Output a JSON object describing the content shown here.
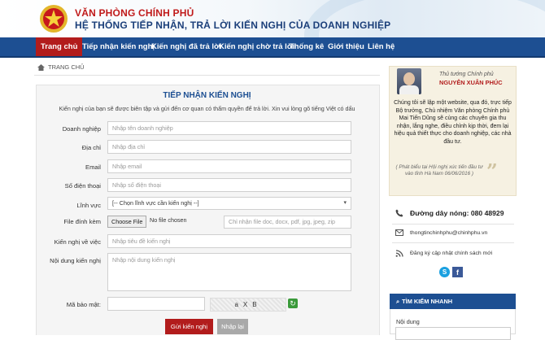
{
  "header": {
    "org_name": "VĂN PHÒNG CHÍNH PHỦ",
    "system_name": "HỆ THỐNG TIẾP NHẬN, TRẢ LỜI KIẾN NGHỊ CỦA DOANH NGHIỆP"
  },
  "nav": {
    "items": [
      "Trang chủ",
      "Tiếp nhận kiến nghị",
      "Kiến nghị đã trả lời",
      "Kiến nghị chờ trả lời",
      "Thống kê",
      "Giới thiệu",
      "Liên hệ"
    ]
  },
  "breadcrumb": {
    "home": "TRANG CHỦ"
  },
  "form": {
    "title": "TIẾP NHẬN KIẾN NGHỊ",
    "description": "Kiến nghị của bạn sẽ được biên tập và gửi đến cơ quan có thẩm quyền để trả lời. Xin vui lòng gõ tiếng Việt có dấu",
    "fields": {
      "business": {
        "label": "Doanh nghiệp",
        "placeholder": "Nhập tên doanh nghiệp"
      },
      "address": {
        "label": "Địa chỉ",
        "placeholder": "Nhập địa chỉ"
      },
      "email": {
        "label": "Email",
        "placeholder": "Nhập email"
      },
      "phone": {
        "label": "Số điện thoại",
        "placeholder": "Nhập số điện thoại"
      },
      "field": {
        "label": "Lĩnh vực",
        "selected": "[-- Chọn lĩnh vực cần kiến nghị --]"
      },
      "attachment": {
        "label": "File đính kèm",
        "button": "Choose File",
        "status": "No file chosen",
        "placeholder": "Chỉ nhận file doc, docx, pdf, jpg, jpeg, zip"
      },
      "subject": {
        "label": "Kiến nghị về việc",
        "placeholder": "Nhập tiêu đề kiến nghị"
      },
      "content": {
        "label": "Nội dung kiến nghị",
        "placeholder": "Nhập nội dung kiến nghị"
      },
      "captcha": {
        "label": "Mã bảo mật:",
        "image_text": "aXB"
      }
    },
    "submit_label": "Gửi kiến nghị",
    "reset_label": "Nhập lại"
  },
  "sidebar": {
    "quote": {
      "role": "Thủ tướng Chính phủ",
      "name": "NGUYỄN XUÂN PHÚC",
      "body": "Chúng tôi sẽ lập một website, qua đó, trực tiếp Bộ trưởng, Chủ nhiệm Văn phòng Chính phủ Mai Tiến Dũng sẽ cùng các chuyên gia thu nhận, lắng nghe, điều chỉnh kịp thời, đem lại hiệu quả thiết thực cho doanh nghiệp, các nhà đầu tư.",
      "note": "( Phát biểu tại Hội nghị xúc tiến đầu tư vào tỉnh Hà Nam 06/06/2016 )"
    },
    "hotline": "Đường dây nóng: 080 48929",
    "email": "thongtinchinhphu@chinhphu.vn",
    "subscribe": "Đăng ký cập nhật chính sách mới",
    "search": {
      "title": "TÌM KIẾM NHANH",
      "content_label": "Nội dung"
    }
  },
  "colors": {
    "nav_blue": "#1d4f92",
    "accent_red": "#b21c1c"
  }
}
